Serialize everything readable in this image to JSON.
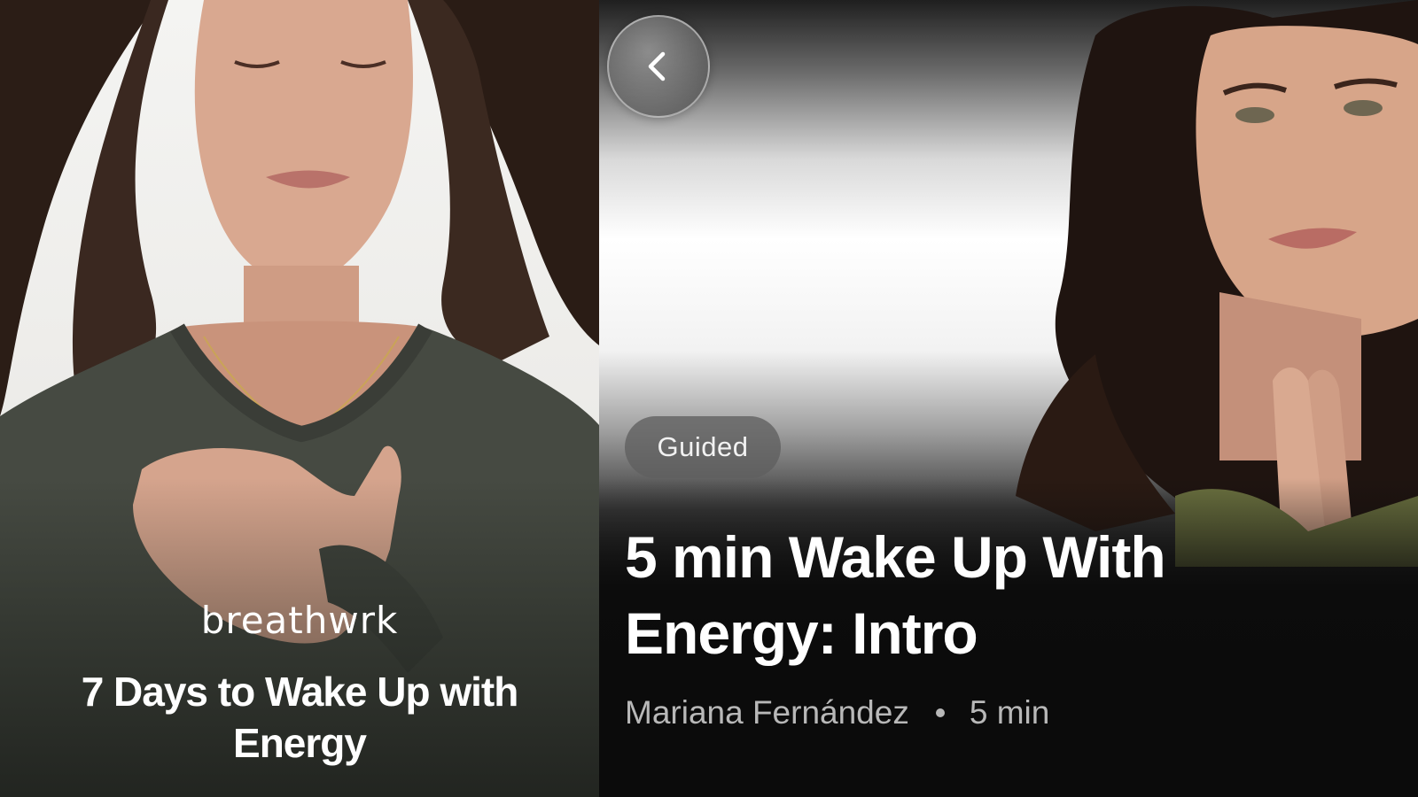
{
  "program_card": {
    "brand": "breathwrk",
    "title": "7 Days to Wake Up with Energy"
  },
  "session": {
    "back_icon": "chevron-left-icon",
    "tag": "Guided",
    "title": "5 min Wake Up With Energy: Intro",
    "instructor": "Mariana Fernández",
    "separator": "•",
    "duration": "5 min"
  },
  "colors": {
    "background": "#0b0b0b",
    "text_primary": "#ffffff",
    "text_secondary": "#b8b8b8",
    "pill_bg": "#5f5f5f"
  }
}
